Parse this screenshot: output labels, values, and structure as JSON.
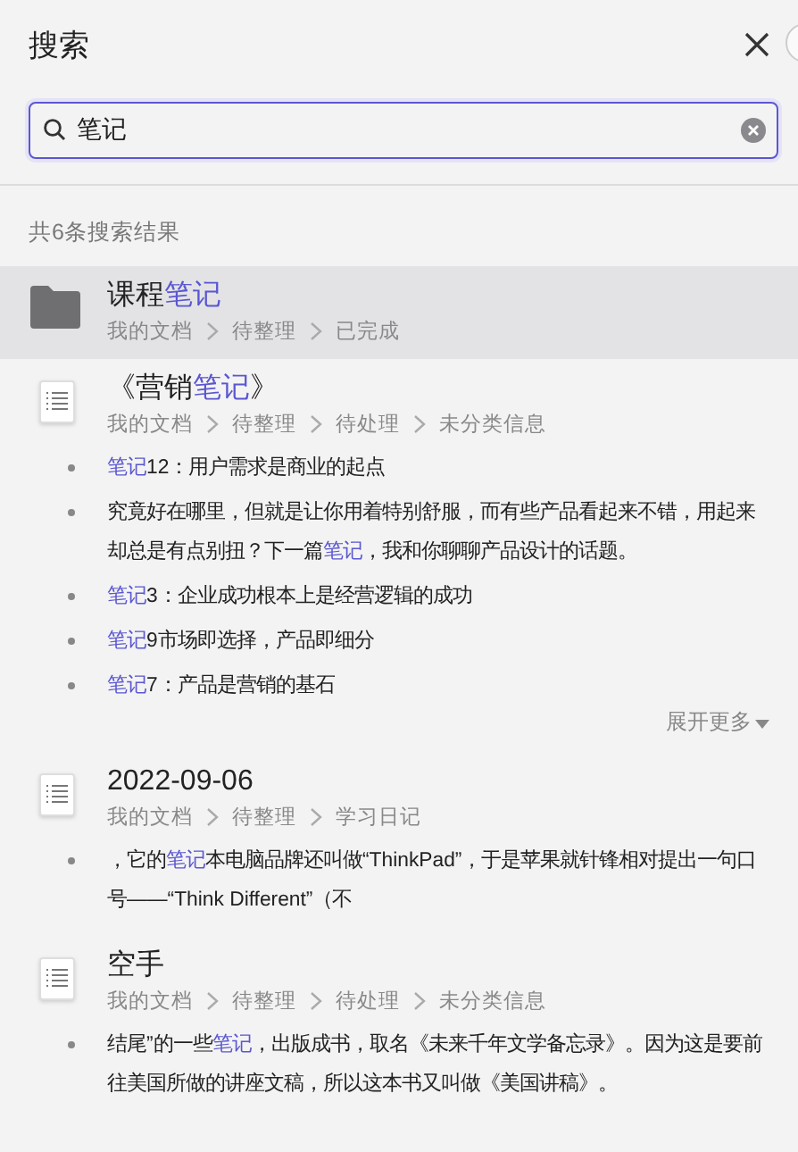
{
  "title": "搜索",
  "search": {
    "value": "笔记"
  },
  "result_count": "共6条搜索结果",
  "results": [
    {
      "kind": "folder",
      "selected": true,
      "title": [
        {
          "text": "课程",
          "match": false
        },
        {
          "text": "笔记",
          "match": true
        }
      ],
      "path": [
        "我的文档",
        "待整理",
        "已完成"
      ]
    },
    {
      "kind": "document",
      "selected": false,
      "title": [
        {
          "text": "《营销",
          "match": false
        },
        {
          "text": "笔记",
          "match": true
        },
        {
          "text": "》",
          "match": false
        }
      ],
      "path": [
        "我的文档",
        "待整理",
        "待处理",
        "未分类信息"
      ],
      "snippets": [
        [
          {
            "text": "笔记",
            "match": true
          },
          {
            "text": "12：用户需求是商业的起点",
            "match": false
          }
        ],
        [
          {
            "text": "究竟好在哪里，但就是让你用着特别舒服，而有些产品看起来不错，用起来却总是有点别扭？下一篇",
            "match": false
          },
          {
            "text": "笔记",
            "match": true
          },
          {
            "text": "，我和你聊聊产品设计的话题。",
            "match": false
          }
        ],
        [
          {
            "text": "笔记",
            "match": true
          },
          {
            "text": "3：企业成功根本上是经营逻辑的成功",
            "match": false
          }
        ],
        [
          {
            "text": "笔记",
            "match": true
          },
          {
            "text": "9市场即选择，产品即细分",
            "match": false
          }
        ],
        [
          {
            "text": "笔记",
            "match": true
          },
          {
            "text": "7：产品是营销的基石",
            "match": false
          }
        ]
      ],
      "expand": "展开更多"
    },
    {
      "kind": "document",
      "selected": false,
      "title": [
        {
          "text": "2022-09-06",
          "match": false
        }
      ],
      "path": [
        "我的文档",
        "待整理",
        "学习日记"
      ],
      "snippets": [
        [
          {
            "text": "，它的",
            "match": false
          },
          {
            "text": "笔记",
            "match": true
          },
          {
            "text": "本电脑品牌还叫做“ThinkPad”，于是苹果就针锋相对提出一句口号——“Think Different”（不",
            "match": false
          }
        ]
      ]
    },
    {
      "kind": "document",
      "selected": false,
      "title": [
        {
          "text": "空手",
          "match": false
        }
      ],
      "path": [
        "我的文档",
        "待整理",
        "待处理",
        "未分类信息"
      ],
      "snippets": [
        [
          {
            "text": "结尾”的一些",
            "match": false
          },
          {
            "text": "笔记",
            "match": true
          },
          {
            "text": "，出版成书，取名《未来千年文学备忘录》。因为这是要前往美国所做的讲座文稿，所以这本书又叫做《美国讲稿》。",
            "match": false
          }
        ]
      ]
    }
  ]
}
